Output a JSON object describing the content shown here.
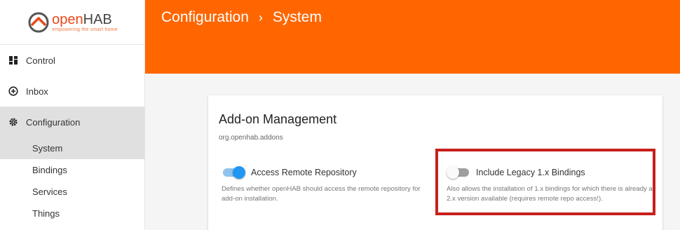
{
  "brand": {
    "name_prefix": "open",
    "name_suffix": "HAB",
    "tagline": "empowering the smart home"
  },
  "sidebar": {
    "items": [
      {
        "label": "Control",
        "icon": "dashboard-icon"
      },
      {
        "label": "Inbox",
        "icon": "add-circle-icon"
      },
      {
        "label": "Configuration",
        "icon": "gear-icon"
      }
    ],
    "sub_items": [
      "System",
      "Bindings",
      "Services",
      "Things"
    ]
  },
  "header": {
    "section": "Configuration",
    "separator": "›",
    "page": "System"
  },
  "card": {
    "title": "Add-on Management",
    "subtitle": "org.openhab.addons",
    "options": [
      {
        "label": "Access Remote Repository",
        "enabled": true,
        "description": "Defines whether openHAB should access the remote repository for add-on installation."
      },
      {
        "label": "Include Legacy 1.x Bindings",
        "enabled": false,
        "description": "Also allows the installation of 1.x bindings for which there is already a 2.x version available (requires remote repo access!)."
      }
    ]
  },
  "colors": {
    "header": "#ff6600",
    "accent": "#2196f3",
    "highlight": "#c8201e"
  }
}
